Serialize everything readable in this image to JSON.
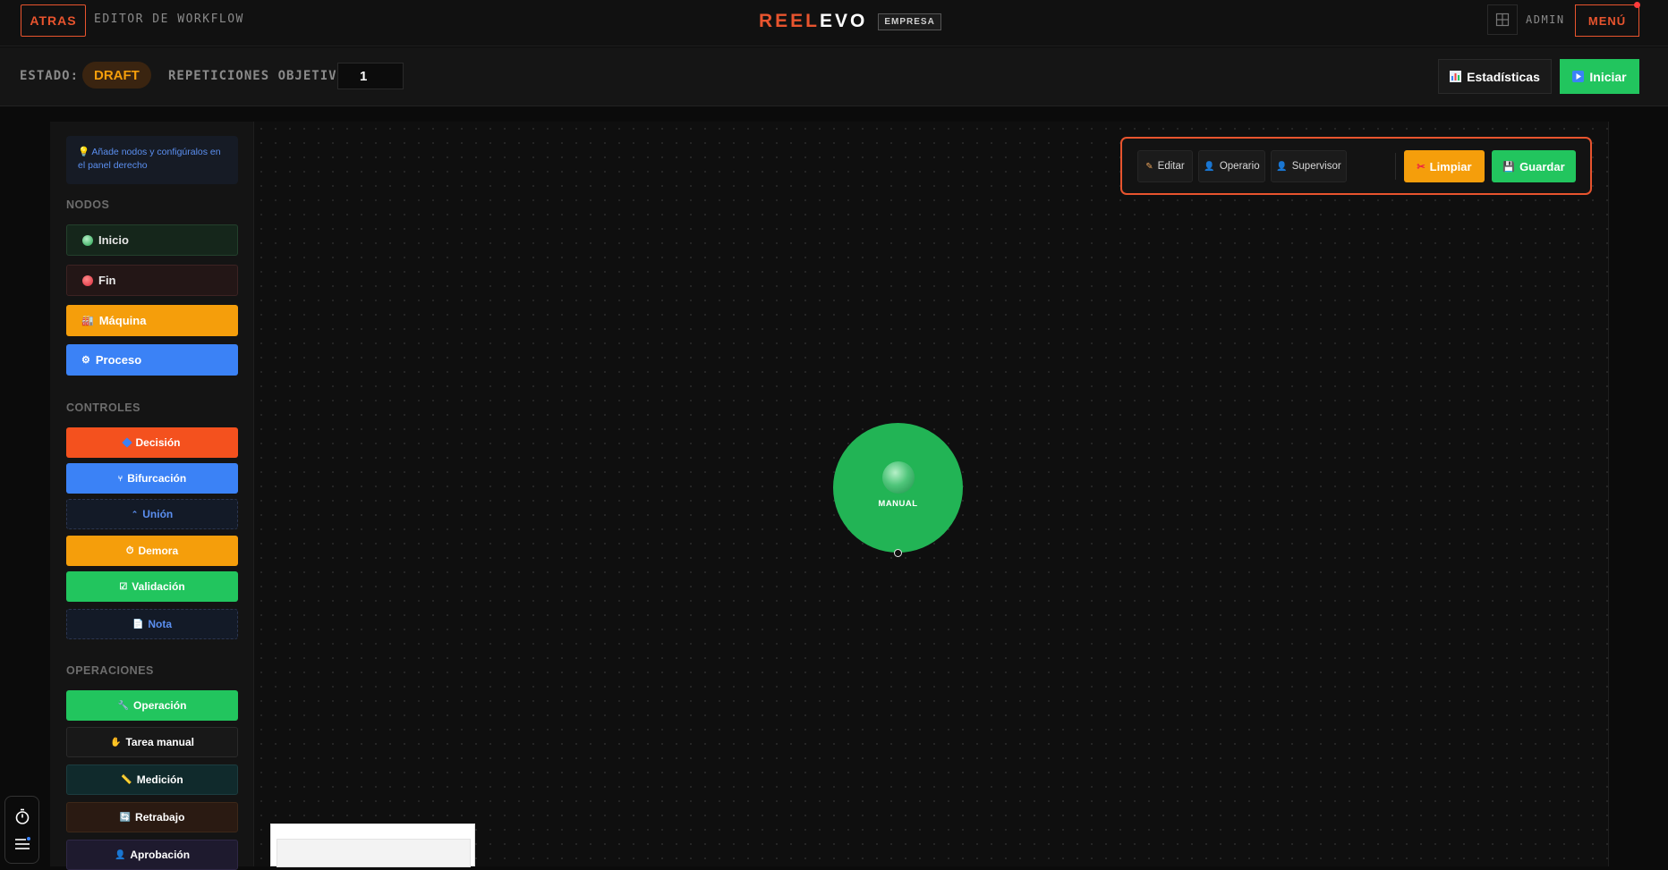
{
  "header": {
    "back_label": "ATRAS",
    "editor_title": "EDITOR DE WORKFLOW",
    "brand_reel": "REEL",
    "brand_evo": "EVO",
    "brand_badge": "EMPRESA",
    "admin_label": "ADMIN",
    "menu_label": "MENÚ"
  },
  "status": {
    "estado_label": "ESTADO:",
    "estado_value": "DRAFT",
    "repeticiones_label": "REPETICIONES OBJETIVO:",
    "repeticiones_value": "1",
    "stats_label": "Estadísticas",
    "iniciar_label": "Iniciar"
  },
  "sidebar": {
    "tip": "💡 Añade nodos y configúralos en el panel derecho",
    "nodos_label": "NODOS",
    "nodos": [
      {
        "label": "Inicio",
        "icon": "green-circle-icon"
      },
      {
        "label": "Fin",
        "icon": "red-circle-icon"
      },
      {
        "label": "Máquina",
        "icon": "factory-icon"
      },
      {
        "label": "Proceso",
        "icon": "gear-icon"
      }
    ],
    "controles_label": "CONTROLES",
    "controles": [
      {
        "label": "Decisión",
        "icon": "blue-diamond-icon"
      },
      {
        "label": "Bifurcación",
        "icon": "split-icon"
      },
      {
        "label": "Unión",
        "icon": "merge-icon"
      },
      {
        "label": "Demora",
        "icon": "clock-icon"
      },
      {
        "label": "Validación",
        "icon": "check-box-icon"
      },
      {
        "label": "Nota",
        "icon": "memo-icon"
      }
    ],
    "operaciones_label": "OPERACIONES",
    "operaciones": [
      {
        "label": "Operación",
        "icon": "wrench-icon"
      },
      {
        "label": "Tarea manual",
        "icon": "hand-icon"
      },
      {
        "label": "Medición",
        "icon": "ruler-icon"
      },
      {
        "label": "Retrabajo",
        "icon": "repeat-icon"
      },
      {
        "label": "Aprobación",
        "icon": "person-icon"
      }
    ]
  },
  "toolbar": {
    "editar": "Editar",
    "operario": "Operario",
    "supervisor": "Supervisor",
    "limpiar": "Limpiar",
    "guardar": "Guardar"
  },
  "canvas": {
    "start_node_label": "MANUAL"
  },
  "colors": {
    "accent": "#e8542e",
    "green": "#22c55e",
    "orange": "#f59e0b",
    "blue": "#3b82f6",
    "red_orange": "#f4511e"
  }
}
